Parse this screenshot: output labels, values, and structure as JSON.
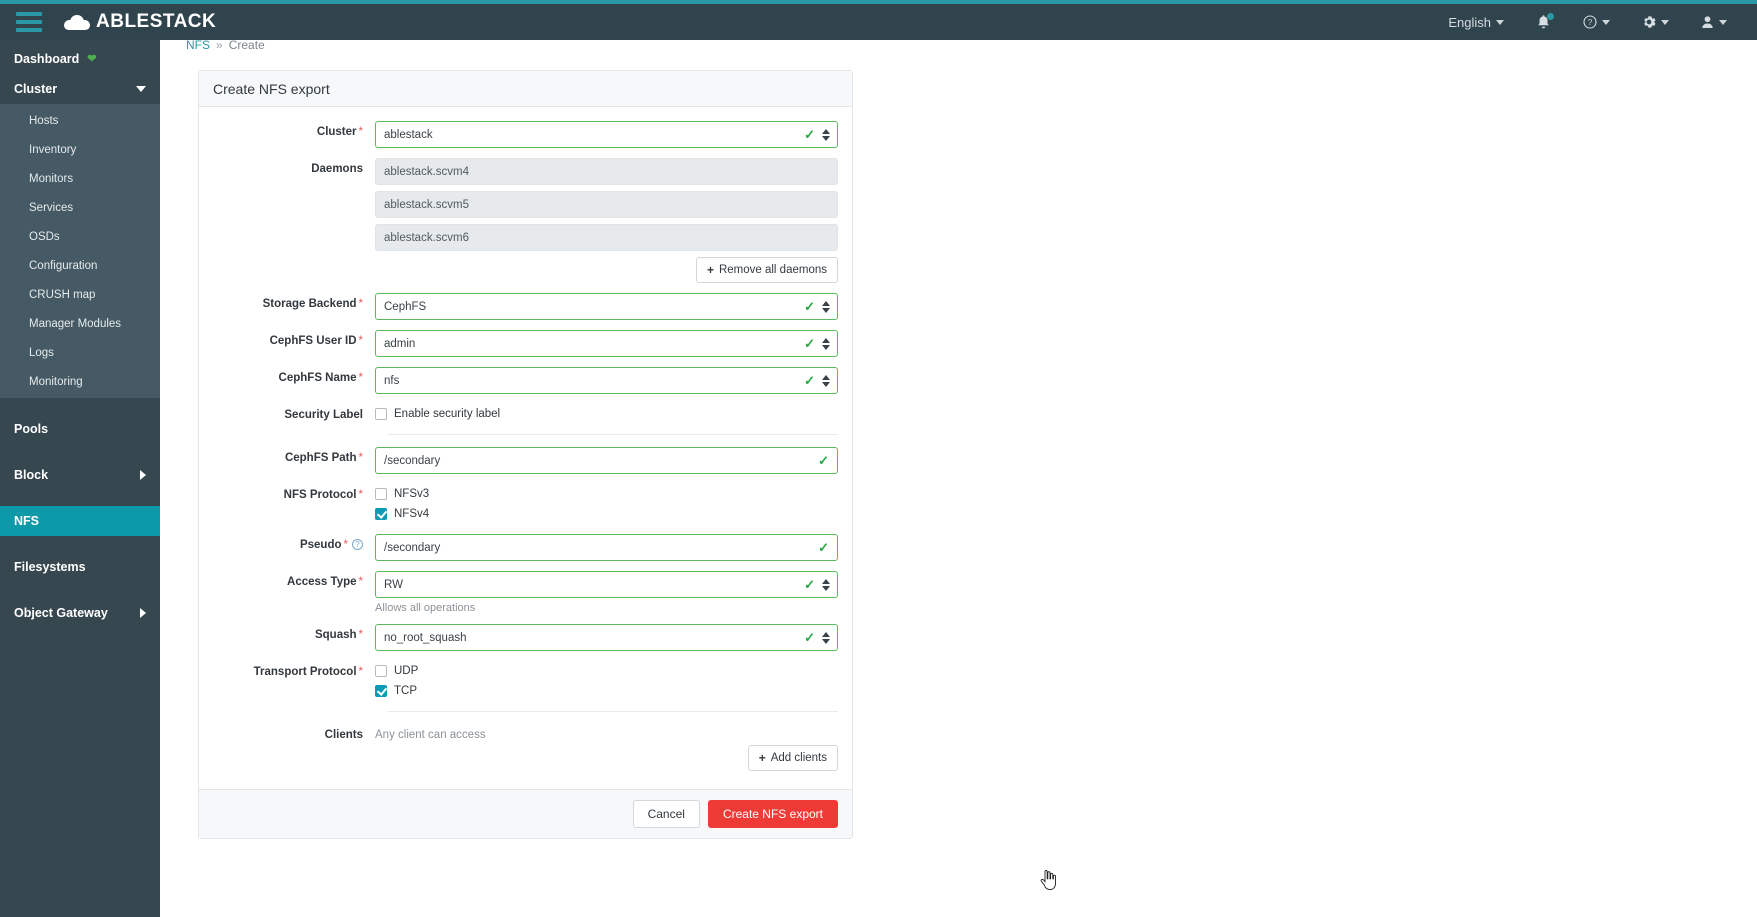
{
  "header": {
    "brand": "ABLESTACK",
    "menu_icon": "hamburger-icon",
    "language": "English",
    "notifications_icon": "bell-icon",
    "help_icon": "help-icon",
    "settings_icon": "gear-icon",
    "user_icon": "user-icon"
  },
  "sidebar": {
    "items": [
      {
        "label": "Dashboard",
        "badge": "heart-icon"
      },
      {
        "label": "Cluster",
        "chevron": "chevron-down-icon"
      },
      {
        "label": "Pools"
      },
      {
        "label": "Block",
        "chevron": "chevron-right-icon"
      },
      {
        "label": "NFS",
        "active": true
      },
      {
        "label": "Filesystems"
      },
      {
        "label": "Object Gateway",
        "chevron": "chevron-right-icon"
      }
    ],
    "cluster_children": [
      "Hosts",
      "Inventory",
      "Monitors",
      "Services",
      "OSDs",
      "Configuration",
      "CRUSH map",
      "Manager Modules",
      "Logs",
      "Monitoring"
    ]
  },
  "breadcrumb": {
    "root": "NFS",
    "separator": "»",
    "current": "Create"
  },
  "card": {
    "title": "Create NFS export",
    "fields": {
      "cluster": {
        "label": "Cluster",
        "value": "ablestack",
        "required": true
      },
      "daemons": {
        "label": "Daemons",
        "values": [
          "ablestack.scvm4",
          "ablestack.scvm5",
          "ablestack.scvm6"
        ],
        "remove_button": "Remove all daemons"
      },
      "storage_backend": {
        "label": "Storage Backend",
        "value": "CephFS",
        "required": true
      },
      "cephfs_user_id": {
        "label": "CephFS User ID",
        "value": "admin",
        "required": true
      },
      "cephfs_name": {
        "label": "CephFS Name",
        "value": "nfs",
        "required": true
      },
      "security_label": {
        "label": "Security Label",
        "checkbox": "Enable security label",
        "checked": false
      },
      "cephfs_path": {
        "label": "CephFS Path",
        "value": "/secondary",
        "required": true
      },
      "nfs_protocol": {
        "label": "NFS Protocol",
        "required": true,
        "options": [
          {
            "label": "NFSv3",
            "checked": false
          },
          {
            "label": "NFSv4",
            "checked": true
          }
        ]
      },
      "pseudo": {
        "label": "Pseudo",
        "value": "/secondary",
        "required": true,
        "help": "?"
      },
      "access_type": {
        "label": "Access Type",
        "value": "RW",
        "required": true,
        "hint": "Allows all operations"
      },
      "squash": {
        "label": "Squash",
        "value": "no_root_squash",
        "required": true
      },
      "transport_protocol": {
        "label": "Transport Protocol",
        "required": true,
        "options": [
          {
            "label": "UDP",
            "checked": false
          },
          {
            "label": "TCP",
            "checked": true
          }
        ]
      },
      "clients": {
        "label": "Clients",
        "text": "Any client can access",
        "add_button": "Add clients"
      }
    },
    "footer": {
      "cancel": "Cancel",
      "submit": "Create NFS export"
    }
  },
  "colors": {
    "accent": "#2b99a5",
    "navbar": "#30444e",
    "sidebar": "#37474f",
    "sidebar_sub": "#455a64",
    "active": "#0d9aa8",
    "valid_border": "#5cb85c",
    "valid_tick": "#28a745",
    "danger": "#ef3b36",
    "checkbox_on": "#0f9bb5",
    "required": "#e05c5c"
  }
}
